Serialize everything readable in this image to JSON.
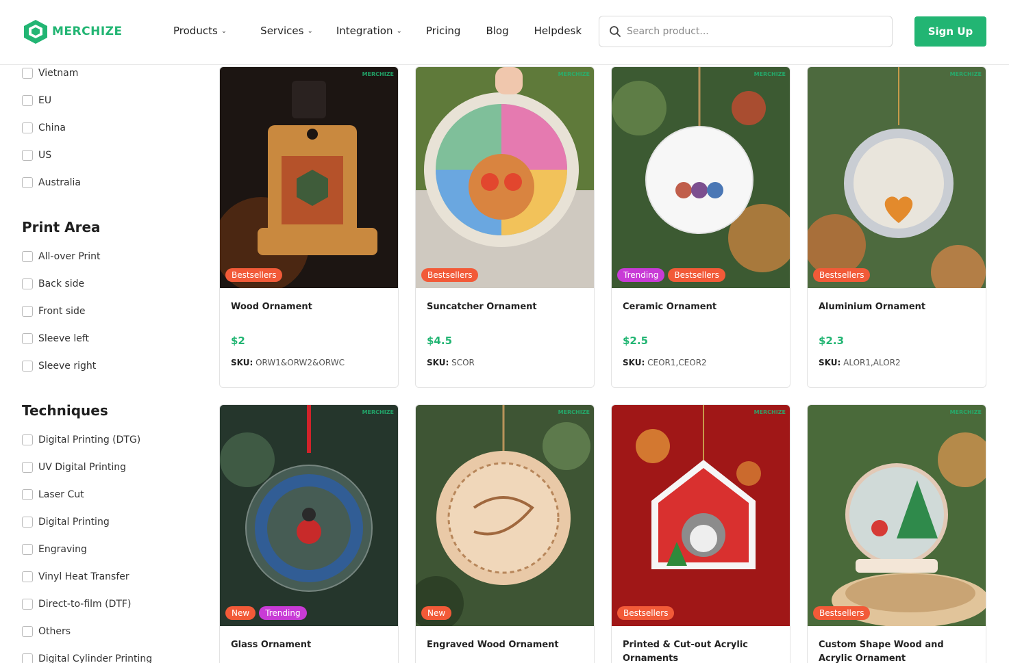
{
  "brand": {
    "name": "MERCHIZE",
    "accent": "#22b573"
  },
  "nav": [
    {
      "label": "Products",
      "dropdown": true
    },
    {
      "label": "Services",
      "dropdown": true
    },
    {
      "label": "Integration",
      "dropdown": true
    },
    {
      "label": "Pricing",
      "dropdown": false
    },
    {
      "label": "Blog",
      "dropdown": false
    },
    {
      "label": "Helpdesk",
      "dropdown": false
    }
  ],
  "search": {
    "placeholder": "Search product...",
    "value": ""
  },
  "signup_label": "Sign Up",
  "filters": {
    "location_options": [
      "Vietnam",
      "EU",
      "China",
      "US",
      "Australia"
    ],
    "print_area": {
      "title": "Print Area",
      "options": [
        "All-over Print",
        "Back side",
        "Front side",
        "Sleeve left",
        "Sleeve right"
      ]
    },
    "techniques": {
      "title": "Techniques",
      "options": [
        "Digital Printing (DTG)",
        "UV Digital Printing",
        "Laser Cut",
        "Digital Printing",
        "Engraving",
        "Vinyl Heat Transfer",
        "Direct-to-film (DTF)",
        "Others",
        "Digital Cylinder Printing"
      ]
    }
  },
  "sku_label": "SKU:",
  "watermark": "MERCHIZE",
  "products": [
    {
      "name": "Wood Ornament",
      "price": "$2",
      "sku": "ORW1&ORW2&ORWC",
      "badges": [
        "Bestsellers"
      ],
      "icon": "halloween-wood-ornament"
    },
    {
      "name": "Suncatcher Ornament",
      "price": "$4.5",
      "sku": "SCOR",
      "badges": [
        "Bestsellers"
      ],
      "icon": "cat-suncatcher-ornament"
    },
    {
      "name": "Ceramic Ornament",
      "price": "$2.5",
      "sku": "CEOR1,CEOR2",
      "badges": [
        "Trending",
        "Bestsellers"
      ],
      "icon": "daughter-ceramic-ornament"
    },
    {
      "name": "Aluminium Ornament",
      "price": "$2.3",
      "sku": "ALOR1,ALOR2",
      "badges": [
        "Bestsellers"
      ],
      "icon": "paw-aluminium-ornament"
    },
    {
      "name": "Glass Ornament",
      "price": "",
      "sku": "",
      "badges": [
        "New",
        "Trending"
      ],
      "icon": "wreath-glass-ornament"
    },
    {
      "name": "Engraved Wood Ornament",
      "price": "",
      "sku": "",
      "badges": [
        "New"
      ],
      "icon": "happy-wedding-wood-ornament"
    },
    {
      "name": "Printed & Cut-out Acrylic Ornaments",
      "price": "",
      "sku": "",
      "badges": [
        "Bestsellers"
      ],
      "icon": "dog-house-acrylic-ornament"
    },
    {
      "name": "Custom Shape Wood and Acrylic Ornament",
      "price": "",
      "sku": "",
      "badges": [
        "Bestsellers"
      ],
      "icon": "snow-globe-ornament"
    }
  ]
}
